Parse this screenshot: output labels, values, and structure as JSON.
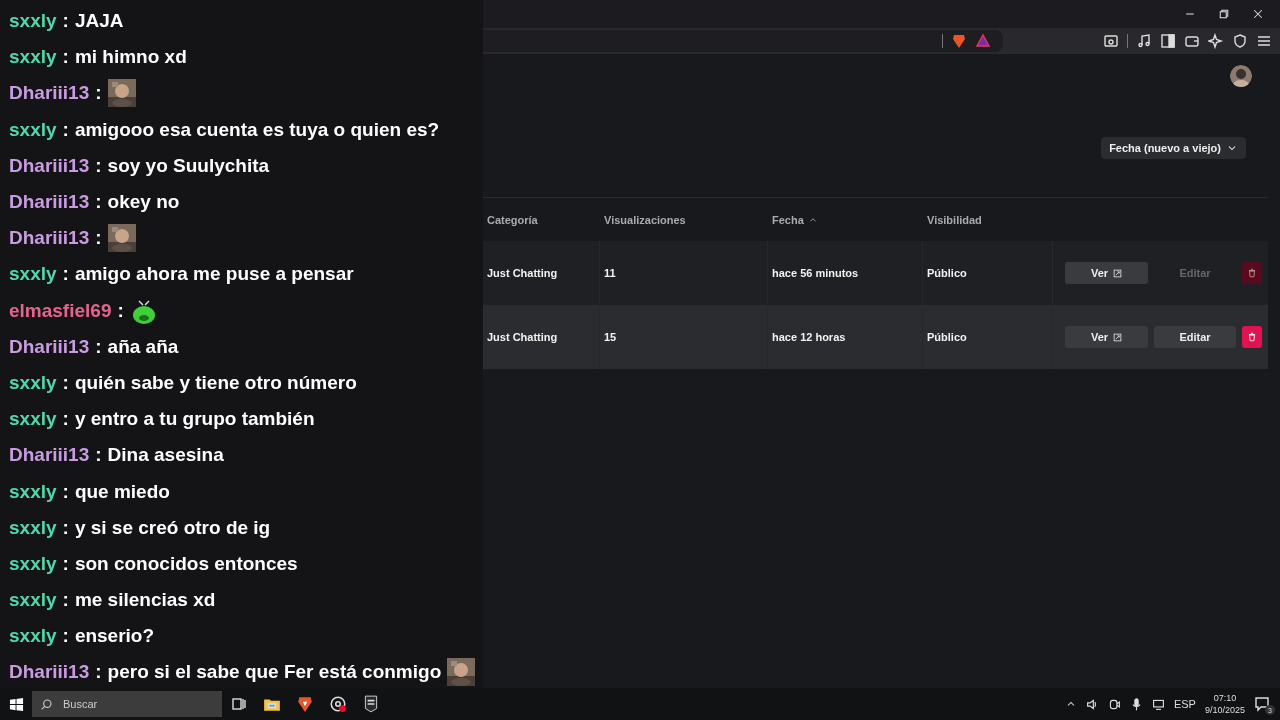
{
  "chat_separator": ":",
  "chat": [
    {
      "user": "sxxly",
      "color": "#4fd8a8",
      "text": "JAJA"
    },
    {
      "user": "sxxly",
      "color": "#4fd8a8",
      "text": "mi himno xd"
    },
    {
      "user": "Dhariii13",
      "color": "#c99ce2"
    },
    {
      "user": "sxxly",
      "color": "#4fd8a8",
      "text": "amigooo esa cuenta es tuya o quien es?"
    },
    {
      "user": "Dhariii13",
      "color": "#c99ce2",
      "text": "soy yo Suulychita"
    },
    {
      "user": "Dhariii13",
      "color": "#c99ce2",
      "text": "okey no"
    },
    {
      "user": "Dhariii13",
      "color": "#c99ce2"
    },
    {
      "user": "sxxly",
      "color": "#4fd8a8",
      "text": "amigo ahora me puse a pensar"
    },
    {
      "user": "elmasfiel69",
      "color": "#e3658e",
      "emote": {
        "kind": "sticker"
      }
    },
    {
      "user": "Dhariii13",
      "color": "#c99ce2",
      "text": "aña aña"
    },
    {
      "user": "sxxly",
      "color": "#4fd8a8",
      "text": "quién sabe y tiene otro número"
    },
    {
      "user": "sxxly",
      "color": "#4fd8a8",
      "text": "y entro a tu grupo también"
    },
    {
      "user": "Dhariii13",
      "color": "#c99ce2",
      "text": "Dina asesina"
    },
    {
      "user": "sxxly",
      "color": "#4fd8a8",
      "text": "que miedo"
    },
    {
      "user": "sxxly",
      "color": "#4fd8a8",
      "text": "y si se creó otro de ig"
    },
    {
      "user": "sxxly",
      "color": "#4fd8a8",
      "text": "son conocidos entonces"
    },
    {
      "user": "sxxly",
      "color": "#4fd8a8",
      "text": "me silencias xd"
    },
    {
      "user": "sxxly",
      "color": "#4fd8a8",
      "text": "enserio?"
    },
    {
      "user": "Dhariii13",
      "color": "#c99ce2",
      "text": "pero si el sabe que Fer está conmigo"
    }
  ],
  "filter": {
    "sort": "Fecha (nuevo a viejo)"
  },
  "table": {
    "columns": [
      {
        "label": "Categoría",
        "sorted": false
      },
      {
        "label": "Visualizaciones",
        "sorted": false
      },
      {
        "label": "Fecha",
        "sorted": true
      },
      {
        "label": "Visibilidad",
        "sorted": false
      }
    ],
    "rows": [
      {
        "category": "Just Chatting",
        "views": "11",
        "date": "hace 56 minutos",
        "visibility": "Público",
        "view_label": "Ver",
        "edit_label": "Editar",
        "disabled": true,
        "hovered": false
      },
      {
        "category": "Just Chatting",
        "views": "15",
        "date": "hace 12 horas",
        "visibility": "Público",
        "view_label": "Ver",
        "edit_label": "Editar",
        "disabled": false,
        "hovered": true
      }
    ]
  },
  "taskbar": {
    "search_placeholder": "Buscar",
    "language": "ESP",
    "time": "07:10",
    "date": "9/10/2025",
    "notifications": "3"
  }
}
